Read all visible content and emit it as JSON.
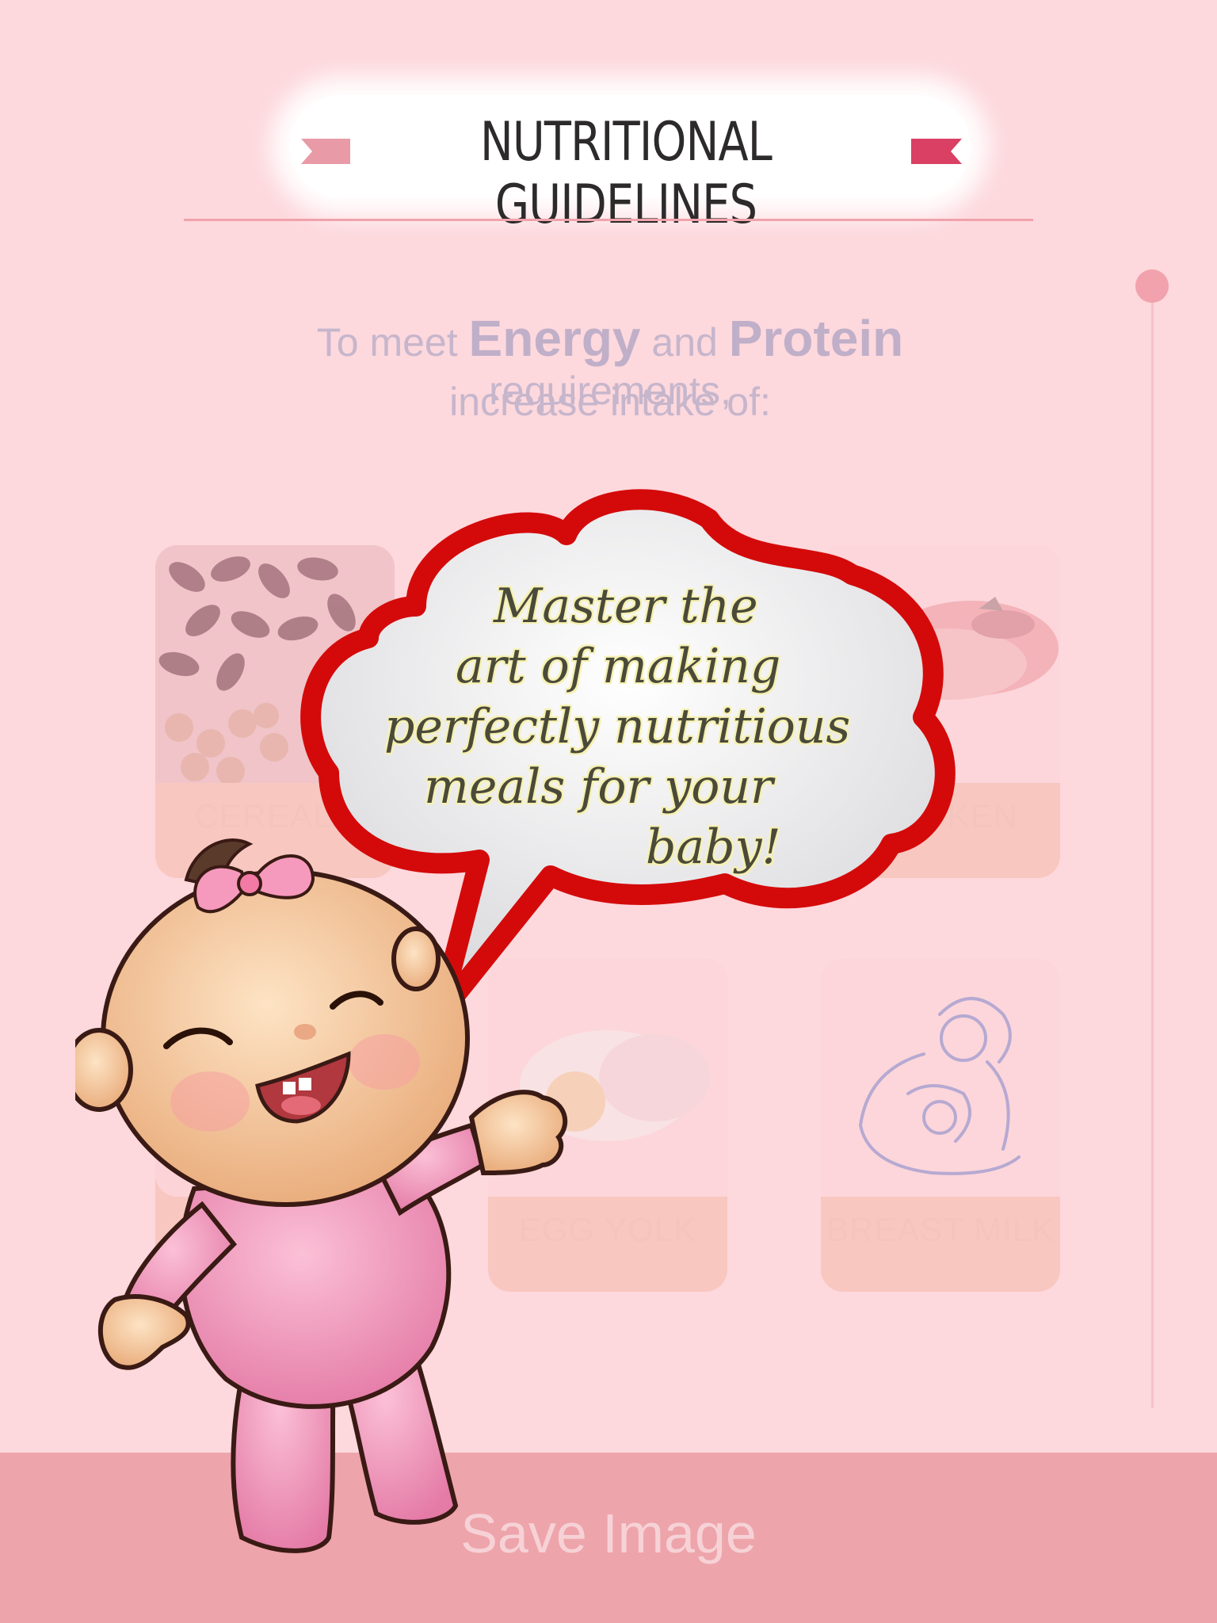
{
  "header": {
    "title": "NUTRITIONAL GUIDELINES"
  },
  "intro": {
    "prefix": "To meet",
    "energy": "Energy",
    "and": "and",
    "protein": "Protein",
    "suffix": "requirements,",
    "line2": "increase intake of:"
  },
  "foods": [
    {
      "label": "CEREALS",
      "icon": "beans-icon"
    },
    {
      "label": "CHICKEN",
      "icon": "chicken-icon"
    },
    {
      "label": "",
      "icon": ""
    },
    {
      "label": "EGG YOLK",
      "icon": "egg-icon"
    },
    {
      "label": "BREAST MILK",
      "icon": "breastfeeding-icon"
    }
  ],
  "bubble": {
    "lines": [
      "Master the",
      "art of making",
      "perfectly nutritious",
      "meals for your",
      "baby!"
    ]
  },
  "footer": {
    "save_label": "Save Image"
  },
  "colors": {
    "background": "#fdd8dd",
    "accent": "#eea4ab",
    "bubble_border": "#d40a0a"
  }
}
